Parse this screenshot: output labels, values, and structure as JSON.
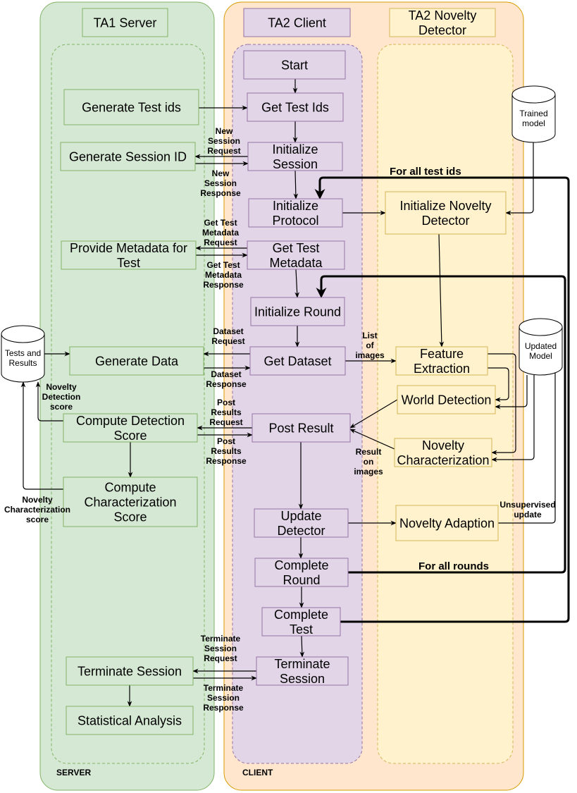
{
  "lanes": {
    "server_footer": "SERVER",
    "client_footer": "CLIENT"
  },
  "headers": {
    "ta1_server": [
      "TA1 Server"
    ],
    "ta2_client": [
      "TA2 Client"
    ],
    "ta2_detector": [
      "TA2 Novelty",
      "Detector"
    ]
  },
  "nodes": {
    "gen_test_ids": [
      "Generate Test ids"
    ],
    "gen_session": [
      "Generate Session ID"
    ],
    "provide_meta": [
      "Provide Metadata for",
      "Test"
    ],
    "gen_data": [
      "Generate Data"
    ],
    "compute_det": [
      "Compute Detection",
      "Score"
    ],
    "compute_char": [
      "Compute",
      "Characterization",
      "Score"
    ],
    "terminate": [
      "Terminate Session"
    ],
    "stats": [
      "Statistical Analysis"
    ],
    "start": [
      "Start"
    ],
    "get_test_ids": [
      "Get Test Ids"
    ],
    "init_session": [
      "Initialize",
      "Session"
    ],
    "init_protocol": [
      "Initialize",
      "Protocol"
    ],
    "get_meta": [
      "Get Test",
      "Metadata"
    ],
    "init_round": [
      "Initialize Round"
    ],
    "get_dataset": [
      "Get Dataset"
    ],
    "post_result": [
      "Post Result"
    ],
    "update_detector": [
      "Update",
      "Detector"
    ],
    "complete_round": [
      "Complete",
      "Round"
    ],
    "complete_test": [
      "Complete",
      "Test"
    ],
    "terminate_session": [
      "Terminate",
      "Session"
    ],
    "init_nd": [
      "Initialize Novelty",
      "Detector"
    ],
    "feature": [
      "Feature",
      "Extraction"
    ],
    "world": [
      "World Detection"
    ],
    "novelty_char": [
      "Novelty",
      "Characterization"
    ],
    "adaption": [
      "Novelty Adaption"
    ]
  },
  "stores": {
    "trained_model": [
      "Trained",
      "model"
    ],
    "updated_model": [
      "Updated",
      "Model"
    ],
    "tests_results": [
      "Tests and",
      "Results"
    ]
  },
  "edge_labels": {
    "new_session_request": [
      "New",
      "Session",
      "Request"
    ],
    "new_session_response": [
      "New",
      "Session",
      "Response"
    ],
    "meta_request": [
      "Get Test",
      "Metadata",
      "Request"
    ],
    "meta_response": [
      "Get Test",
      "Metadata",
      "Response"
    ],
    "dataset_request": [
      "Dataset",
      "Request"
    ],
    "dataset_response": [
      "Dataset",
      "Response"
    ],
    "list_images": [
      "List",
      "of",
      "images"
    ],
    "novelty_det_score": [
      "Novelty",
      "Detection",
      "score"
    ],
    "post_request": [
      "Post",
      "Results",
      "Request"
    ],
    "post_response": [
      "Post",
      "Results",
      "Response"
    ],
    "result_images": [
      "Result",
      "on",
      "images"
    ],
    "novelty_char_score": [
      "Novelty",
      "Characterization",
      "score"
    ],
    "unsupervised": [
      "Unsupervised",
      "update"
    ],
    "term_request": [
      "Terminate",
      "Session",
      "Request"
    ],
    "term_response": [
      "Terminate",
      "Session",
      "Response"
    ]
  },
  "loop_labels": {
    "all_test_ids": "For all test ids",
    "all_rounds": "For all rounds"
  },
  "colors": {
    "server_fill": "#d5e8d4",
    "server_stroke": "#82b366",
    "client_fill": "#ffe6cc",
    "client_stroke": "#d79b00",
    "ta2client_fill": "#e1d5e7",
    "ta2client_stroke": "#9673a6",
    "detector_fill": "#fff2cc",
    "detector_stroke": "#d6b656"
  }
}
